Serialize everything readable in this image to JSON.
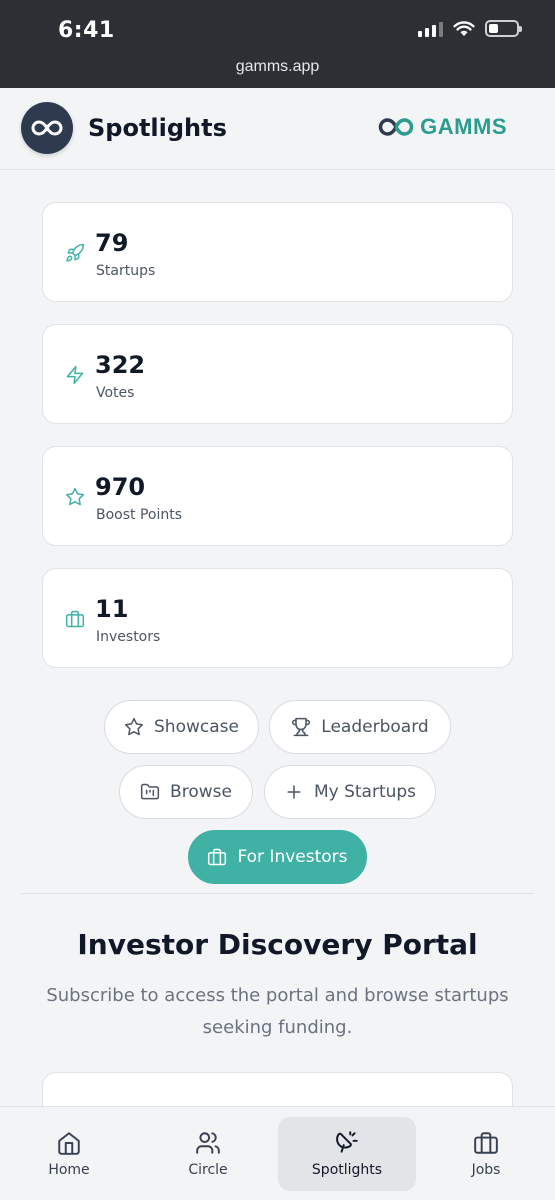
{
  "status_bar": {
    "time": "6:41",
    "url": "gamms.app"
  },
  "header": {
    "title": "Spotlights",
    "brand": "GAMMS"
  },
  "stats": [
    {
      "value": "79",
      "label": "Startups",
      "icon": "rocket-icon"
    },
    {
      "value": "322",
      "label": "Votes",
      "icon": "lightning-icon"
    },
    {
      "value": "970",
      "label": "Boost Points",
      "icon": "star-icon"
    },
    {
      "value": "11",
      "label": "Investors",
      "icon": "briefcase-icon"
    }
  ],
  "actions": {
    "showcase": "Showcase",
    "leaderboard": "Leaderboard",
    "browse": "Browse",
    "my_startups": "My Startups",
    "for_investors": "For Investors"
  },
  "portal": {
    "title": "Investor Discovery Portal",
    "description": "Subscribe to access the portal and browse startups seeking funding."
  },
  "nav": {
    "home": "Home",
    "circle": "Circle",
    "spotlights": "Spotlights",
    "jobs": "Jobs",
    "active": "spotlights"
  },
  "colors": {
    "accent": "#3fb1a5",
    "brand": "#2a9d8f",
    "header_dark": "#2c2f33"
  }
}
